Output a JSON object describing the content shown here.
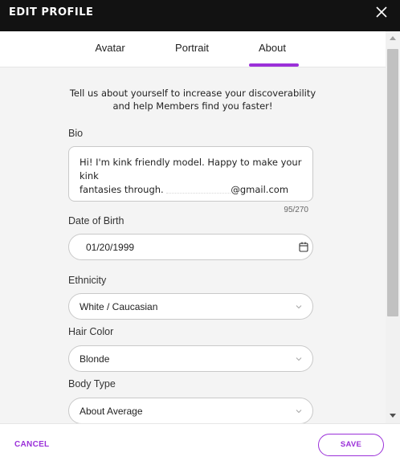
{
  "header": {
    "title": "EDIT PROFILE",
    "close_icon": "close-icon"
  },
  "tabs": [
    {
      "label": "Avatar",
      "active": false
    },
    {
      "label": "Portrait",
      "active": false
    },
    {
      "label": "About",
      "active": true
    }
  ],
  "colors": {
    "accent": "#9b30d9",
    "header_bg": "#121212",
    "panel_bg": "#f4f4f4"
  },
  "intro": "Tell us about yourself to increase your discoverability and help Members find you faster!",
  "bio": {
    "label": "Bio",
    "value_line1": "Hi! I'm kink friendly model. Happy to make your kink",
    "value_line2_prefix": "fantasies through.",
    "value_line2_suffix": "@gmail.com",
    "counter": "95/270"
  },
  "dob": {
    "label": "Date of Birth",
    "value": "01/20/1999",
    "icon": "calendar-icon"
  },
  "ethnicity": {
    "label": "Ethnicity",
    "value": "White / Caucasian"
  },
  "hair_color": {
    "label": "Hair Color",
    "value": "Blonde"
  },
  "body_type": {
    "label": "Body Type",
    "value": "About Average"
  },
  "footer": {
    "cancel_label": "CANCEL",
    "save_label": "SAVE"
  }
}
